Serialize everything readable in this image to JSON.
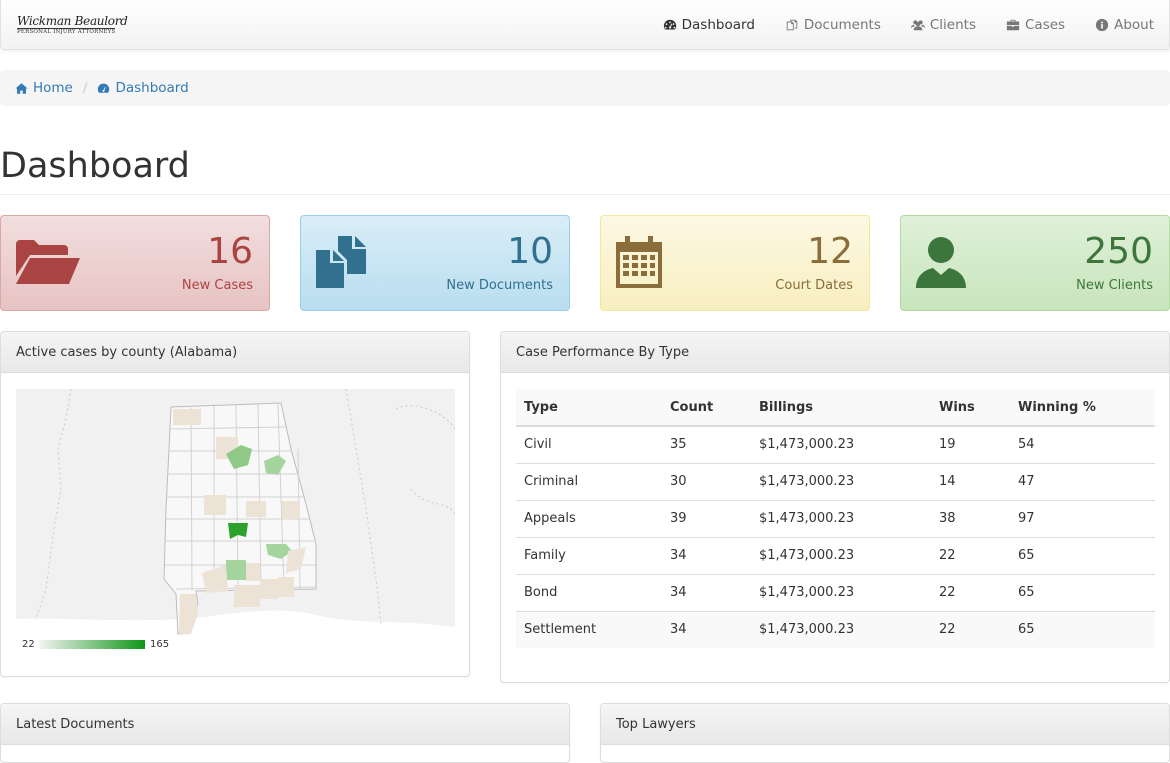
{
  "brand": {
    "name": "Wickman Beaulord",
    "subtitle": "PERSONAL INJURY ATTORNEYS"
  },
  "nav": [
    {
      "label": "Dashboard",
      "icon": "dashboard-icon",
      "active": true
    },
    {
      "label": "Documents",
      "icon": "documents-icon"
    },
    {
      "label": "Clients",
      "icon": "users-icon"
    },
    {
      "label": "Cases",
      "icon": "briefcase-icon"
    },
    {
      "label": "About",
      "icon": "info-icon"
    }
  ],
  "breadcrumb": [
    {
      "label": "Home",
      "icon": "home-icon"
    },
    {
      "label": "Dashboard",
      "icon": "dashboard-icon"
    }
  ],
  "page_title": "Dashboard",
  "stats": [
    {
      "value": "16",
      "label": "New Cases",
      "icon": "folder-open-icon",
      "color": "#a94442"
    },
    {
      "value": "10",
      "label": "New Documents",
      "icon": "files-icon",
      "color": "#31708f"
    },
    {
      "value": "12",
      "label": "Court Dates",
      "icon": "calendar-icon",
      "color": "#8a6d3b"
    },
    {
      "value": "250",
      "label": "New Clients",
      "icon": "user-icon",
      "color": "#3c763d"
    }
  ],
  "map_panel": {
    "title": "Active cases by county (Alabama)",
    "legend_min": "22",
    "legend_max": "165",
    "scale_colors": [
      "#f4f4f4",
      "#109618"
    ]
  },
  "performance": {
    "title": "Case Performance By Type",
    "columns": [
      "Type",
      "Count",
      "Billings",
      "Wins",
      "Winning %"
    ],
    "rows": [
      [
        "Civil",
        "35",
        "$1,473,000.23",
        "19",
        "54"
      ],
      [
        "Criminal",
        "30",
        "$1,473,000.23",
        "14",
        "47"
      ],
      [
        "Appeals",
        "39",
        "$1,473,000.23",
        "38",
        "97"
      ],
      [
        "Family",
        "34",
        "$1,473,000.23",
        "22",
        "65"
      ],
      [
        "Bond",
        "34",
        "$1,473,000.23",
        "22",
        "65"
      ],
      [
        "Settlement",
        "34",
        "$1,473,000.23",
        "22",
        "65"
      ]
    ]
  },
  "latest_documents": {
    "title": "Latest Documents"
  },
  "top_lawyers": {
    "title": "Top Lawyers"
  }
}
